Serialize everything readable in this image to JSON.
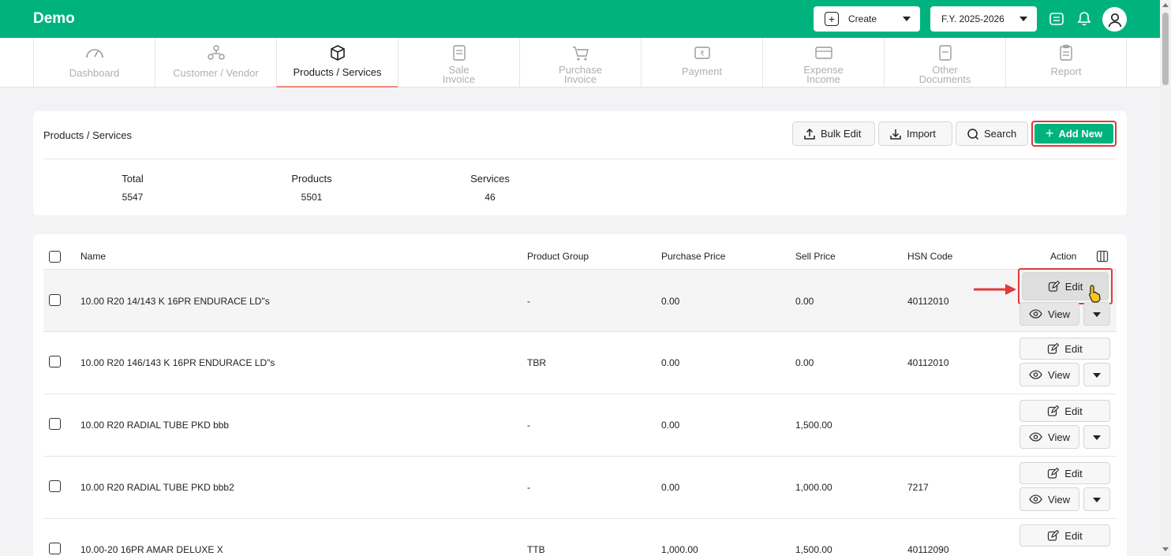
{
  "app": {
    "brand": "Demo"
  },
  "topbar": {
    "create_label": "Create",
    "fy_label": "F.Y. 2025-2026",
    "icons": [
      "keyboard-icon",
      "bell-icon",
      "user-avatar-icon"
    ]
  },
  "nav": {
    "items": [
      {
        "label": "Dashboard",
        "icon": "gauge-icon"
      },
      {
        "label": "Customer / Vendor",
        "icon": "people-icon"
      },
      {
        "label": "Products / Services",
        "icon": "box-icon"
      },
      {
        "label": "Sale\nInvoice",
        "icon": "invoice-icon"
      },
      {
        "label": "Purchase\nInvoice",
        "icon": "cart-icon"
      },
      {
        "label": "Payment",
        "icon": "payment-icon"
      },
      {
        "label": "Expense\nIncome",
        "icon": "expense-icon"
      },
      {
        "label": "Other\nDocuments",
        "icon": "documents-icon"
      },
      {
        "label": "Report",
        "icon": "report-icon"
      }
    ],
    "active_index": 2
  },
  "summary": {
    "title": "Products / Services",
    "buttons": {
      "bulk_edit": "Bulk Edit",
      "import": "Import",
      "search": "Search",
      "add_new": "Add New"
    },
    "stats": [
      {
        "label": "Total",
        "value": "5547"
      },
      {
        "label": "Products",
        "value": "5501"
      },
      {
        "label": "Services",
        "value": "46"
      }
    ]
  },
  "table": {
    "headers": {
      "name": "Name",
      "group": "Product Group",
      "purchase": "Purchase Price",
      "sell": "Sell Price",
      "hsn": "HSN Code",
      "action": "Action"
    },
    "edit_label": "Edit",
    "view_label": "View",
    "rows": [
      {
        "name": "10.00 R20 14/143 K 16PR ENDURACE LD\"s",
        "group": "-",
        "purchase": "0.00",
        "sell": "0.00",
        "hsn": "40112010"
      },
      {
        "name": "10.00 R20 146/143 K 16PR ENDURACE LD\"s",
        "group": "TBR",
        "purchase": "0.00",
        "sell": "0.00",
        "hsn": "40112010"
      },
      {
        "name": "10.00 R20 RADIAL TUBE PKD bbb",
        "group": "-",
        "purchase": "0.00",
        "sell": "1,500.00",
        "hsn": ""
      },
      {
        "name": "10.00 R20 RADIAL TUBE PKD bbb2",
        "group": "-",
        "purchase": "0.00",
        "sell": "1,000.00",
        "hsn": "7217"
      },
      {
        "name": "10.00-20 16PR AMAR DELUXE X",
        "group": "TTB",
        "purchase": "1,000.00",
        "sell": "1,500.00",
        "hsn": "40112090"
      }
    ]
  },
  "colors": {
    "brand": "#00b37e",
    "highlight": "#e03a3a",
    "active_tab_underline": "#f08a7a"
  }
}
